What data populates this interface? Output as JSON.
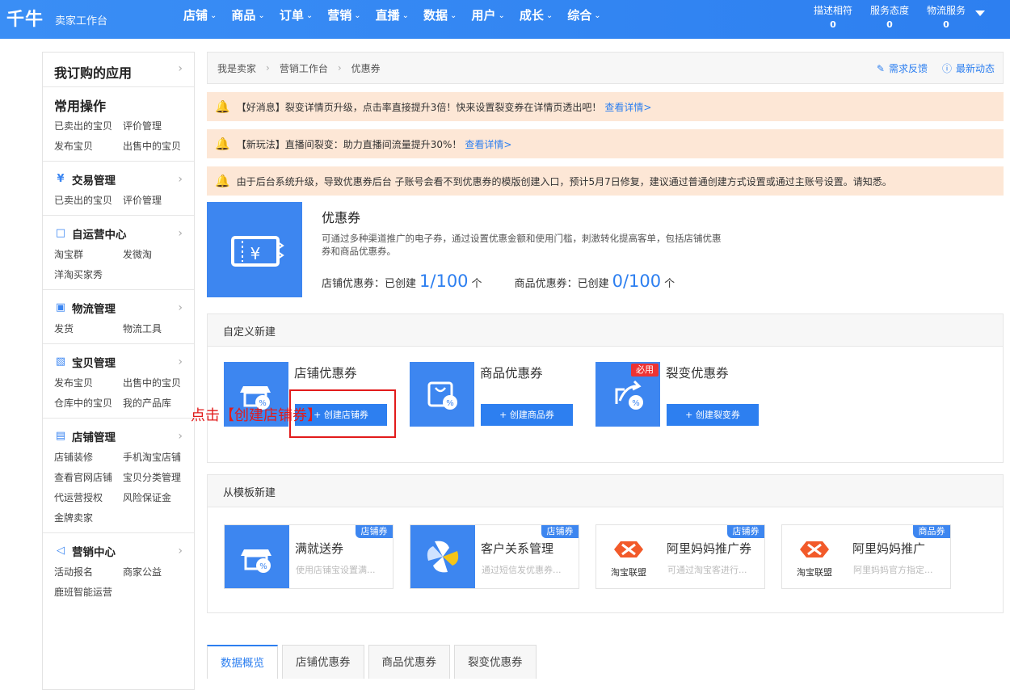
{
  "brand": {
    "logo": "千牛",
    "subtitle": "卖家工作台"
  },
  "nav": [
    "店铺",
    "商品",
    "订单",
    "营销",
    "直播",
    "数据",
    "用户",
    "成长",
    "综合"
  ],
  "metrics": [
    {
      "label": "描述相符",
      "value": "0"
    },
    {
      "label": "服务态度",
      "value": "0"
    },
    {
      "label": "物流服务",
      "value": "0"
    }
  ],
  "sidebar": {
    "subscribed": "我订购的应用",
    "common": {
      "title": "常用操作",
      "links": [
        "已卖出的宝贝",
        "评价管理",
        "发布宝贝",
        "出售中的宝贝"
      ]
    },
    "sections": [
      {
        "title": "交易管理",
        "icon": "yen-icon",
        "links": [
          "已卖出的宝贝",
          "评价管理"
        ]
      },
      {
        "title": "自运营中心",
        "icon": "chat-icon",
        "links": [
          "淘宝群",
          "发微淘",
          "洋淘买家秀"
        ]
      },
      {
        "title": "物流管理",
        "icon": "truck-icon",
        "links": [
          "发货",
          "物流工具"
        ]
      },
      {
        "title": "宝贝管理",
        "icon": "bag-icon",
        "links": [
          "发布宝贝",
          "出售中的宝贝",
          "仓库中的宝贝",
          "我的产品库"
        ]
      },
      {
        "title": "店铺管理",
        "icon": "store-icon",
        "links": [
          "店铺装修",
          "手机淘宝店铺",
          "查看官网店铺",
          "宝贝分类管理",
          "代运营授权",
          "风险保证金",
          "金牌卖家"
        ]
      },
      {
        "title": "营销中心",
        "icon": "megaphone-icon",
        "links": [
          "活动报名",
          "商家公益",
          "鹿班智能运营"
        ]
      }
    ]
  },
  "breadcrumb": [
    "我是卖家",
    "营销工作台",
    "优惠券"
  ],
  "breadcrumb_actions": [
    "需求反馈",
    "最新动态"
  ],
  "notices": [
    {
      "text": "【好消息】裂变详情页升级，点击率直接提升3倍！快来设置裂变券在详情页透出吧！",
      "link": "查看详情>"
    },
    {
      "text": "【新玩法】直播间裂变：助力直播间流量提升30%！",
      "link": "查看详情>"
    },
    {
      "text": "由于后台系统升级，导致优惠券后台 子账号会看不到优惠券的模版创建入口，预计5月7日修复，建议通过普通创建方式设置或通过主账号设置。请知悉。",
      "link": ""
    }
  ],
  "intro": {
    "title": "优惠券",
    "desc": "可通过多种渠道推广的电子券，通过设置优惠金额和使用门槛，刺激转化提高客单，包括店铺优惠券和商品优惠券。",
    "shop_label": "店铺优惠券：已创建",
    "shop_count": "1/100",
    "shop_unit": "个",
    "item_label": "商品优惠券：已创建",
    "item_count": "0/100",
    "item_unit": "个"
  },
  "custom": {
    "header": "自定义新建",
    "cards": [
      {
        "title": "店铺优惠券",
        "button": "+ 创建店铺券"
      },
      {
        "title": "商品优惠券",
        "button": "+ 创建商品券"
      },
      {
        "title": "裂变优惠券",
        "button": "+ 创建裂变券",
        "badge": "必用"
      }
    ]
  },
  "annotation": "点击【创建店铺券】",
  "templates": {
    "header": "从模板新建",
    "cards": [
      {
        "title": "满就送券",
        "sub": "使用店铺宝设置满...",
        "tag": "店铺券"
      },
      {
        "title": "客户关系管理",
        "sub": "通过短信发优惠券...",
        "tag": "店铺券"
      },
      {
        "title": "阿里妈妈推广券",
        "sub": "可通过淘宝客进行...",
        "tag": "店铺券",
        "logo": "淘宝联盟"
      },
      {
        "title": "阿里妈妈推广",
        "sub": "阿里妈妈官方指定...",
        "tag": "商品券",
        "logo": "淘宝联盟"
      }
    ]
  },
  "tabs": [
    "数据概览",
    "店铺优惠券",
    "商品优惠券",
    "裂变优惠券"
  ],
  "colors": {
    "primary": "#2d7ff0",
    "notice_bg": "#fde7d6",
    "highlight": "#e21b1b"
  }
}
